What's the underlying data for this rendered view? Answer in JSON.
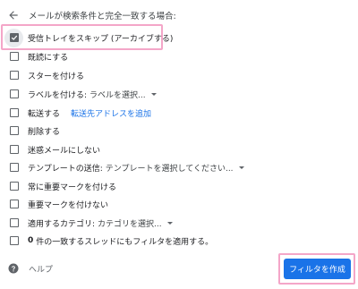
{
  "header": {
    "title": "メールが検索条件と完全一致する場合:"
  },
  "options": [
    {
      "id": "skip_inbox",
      "label": "受信トレイをスキップ (アーカイブする)",
      "checked": true
    },
    {
      "id": "mark_read",
      "label": "既読にする",
      "checked": false
    },
    {
      "id": "star",
      "label": "スターを付ける",
      "checked": false
    },
    {
      "id": "apply_label",
      "label": "ラベルを付ける:",
      "dropdown": "ラベルを選択...",
      "checked": false
    },
    {
      "id": "forward",
      "label": "転送する",
      "link": "転送先アドレスを追加",
      "checked": false
    },
    {
      "id": "delete",
      "label": "削除する",
      "checked": false
    },
    {
      "id": "never_spam",
      "label": "迷惑メールにしない",
      "checked": false
    },
    {
      "id": "send_template",
      "label": "テンプレートの送信:",
      "dropdown": "テンプレートを選択してください...",
      "checked": false
    },
    {
      "id": "always_important",
      "label": "常に重要マークを付ける",
      "checked": false
    },
    {
      "id": "never_important",
      "label": "重要マークを付けない",
      "checked": false
    },
    {
      "id": "category",
      "label": "適用するカテゴリ:",
      "dropdown": "カテゴリを選択...",
      "checked": false
    },
    {
      "id": "apply_existing",
      "count": "0",
      "label": "件の一致するスレッドにもフィルタを適用する。",
      "checked": false
    }
  ],
  "footer": {
    "help_label": "ヘルプ",
    "create_label": "フィルタを作成"
  },
  "colors": {
    "accent": "#1a73e8",
    "highlight": "#f4a6c8",
    "checkbox": "#5f6368"
  }
}
